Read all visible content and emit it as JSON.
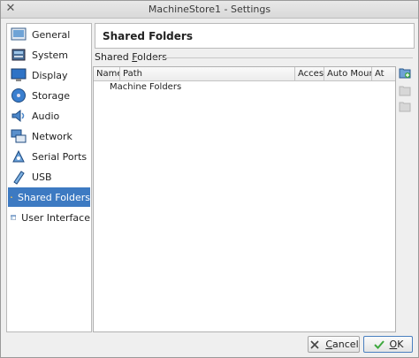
{
  "window": {
    "title": "MachineStore1 - Settings"
  },
  "sidebar": {
    "items": [
      {
        "label": "General",
        "icon": "general-icon"
      },
      {
        "label": "System",
        "icon": "system-icon"
      },
      {
        "label": "Display",
        "icon": "display-icon"
      },
      {
        "label": "Storage",
        "icon": "storage-icon"
      },
      {
        "label": "Audio",
        "icon": "audio-icon"
      },
      {
        "label": "Network",
        "icon": "network-icon"
      },
      {
        "label": "Serial Ports",
        "icon": "serial-ports-icon"
      },
      {
        "label": "USB",
        "icon": "usb-icon"
      },
      {
        "label": "Shared Folders",
        "icon": "shared-folders-icon",
        "selected": true
      },
      {
        "label": "User Interface",
        "icon": "user-interface-icon"
      }
    ]
  },
  "main": {
    "title": "Shared Folders",
    "group": {
      "label_pre": "Shared ",
      "label_mn": "F",
      "label_post": "olders"
    },
    "table": {
      "columns": [
        "Name",
        "Path",
        "Access",
        "Auto Mount",
        "At"
      ],
      "rows": [
        {
          "label": "Machine Folders"
        }
      ]
    },
    "tools": [
      "add-folder-icon",
      "edit-folder-icon",
      "remove-folder-icon"
    ]
  },
  "buttons": {
    "cancel_mn": "C",
    "cancel_rest": "ancel",
    "ok_mn": "O",
    "ok_rest": "K"
  },
  "colors": {
    "selection": "#3d7ac2",
    "accent_green": "#3ea83e"
  }
}
